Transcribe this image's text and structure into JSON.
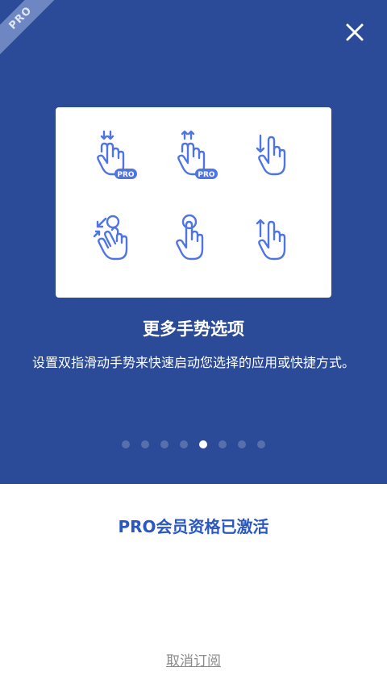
{
  "badge": {
    "label": "PRO"
  },
  "close": {
    "icon": "close-icon"
  },
  "feature": {
    "title": "更多手势选项",
    "description": "设置双指滑动手势来快速启动您选择的应用或快捷方式。"
  },
  "gestures": [
    {
      "icon": "two-finger-swipe-down-icon",
      "badge": "PRO"
    },
    {
      "icon": "two-finger-swipe-up-icon",
      "badge": "PRO"
    },
    {
      "icon": "swipe-down-icon"
    },
    {
      "icon": "pinch-icon"
    },
    {
      "icon": "tap-icon"
    },
    {
      "icon": "swipe-up-icon"
    }
  ],
  "pagination": {
    "total": 8,
    "active_index": 4
  },
  "status": {
    "text": "PRO会员资格已激活"
  },
  "cancel": {
    "label": "取消订阅"
  },
  "colors": {
    "hero_bg": "#2b4a97",
    "accent": "#2b57c1",
    "icon": "#4f74e3"
  }
}
